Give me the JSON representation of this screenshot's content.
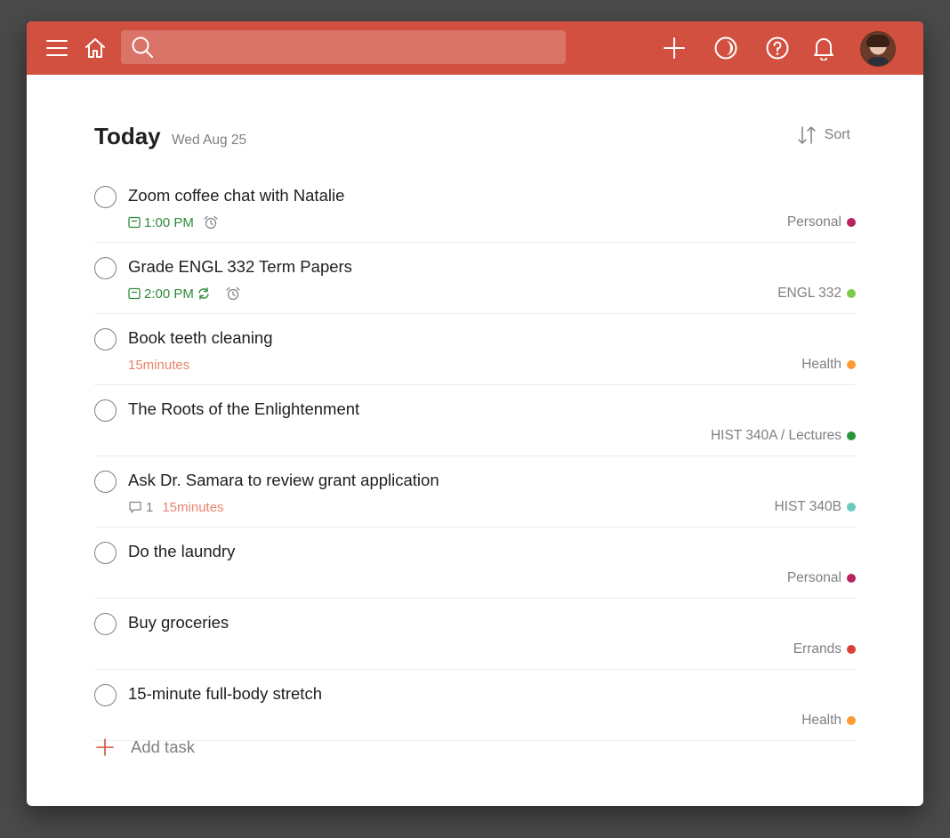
{
  "colors": {
    "topbar": "#d1503f",
    "search_bg": "#db7468",
    "due_green": "#2e8b3a",
    "duration_orange": "#e8846c",
    "add_plus": "#d1503f"
  },
  "topbar": {
    "icons": [
      "menu-icon",
      "home-icon",
      "search-icon",
      "plus-icon",
      "productivity-icon",
      "help-icon",
      "bell-icon"
    ],
    "search": {
      "placeholder": "",
      "value": ""
    }
  },
  "header": {
    "title": "Today",
    "date": "Wed Aug 25",
    "sort_label": "Sort"
  },
  "tasks": [
    {
      "title": "Zoom coffee chat with Natalie",
      "due": "1:00 PM",
      "recurring": false,
      "alarm": true,
      "project": "Personal",
      "project_color": "#b8255f"
    },
    {
      "title": "Grade ENGL 332 Term Papers",
      "due": "2:00 PM",
      "recurring": true,
      "alarm": true,
      "project": "ENGL 332",
      "project_color": "#7ecc49"
    },
    {
      "title": "Book teeth cleaning",
      "duration": "15minutes",
      "project": "Health",
      "project_color": "#ff9933"
    },
    {
      "title": "The Roots of the Enlightenment",
      "project": "HIST 340A / Lectures",
      "project_color": "#299438"
    },
    {
      "title": "Ask Dr. Samara to review grant application",
      "comments": "1",
      "duration": "15minutes",
      "project": "HIST 340B",
      "project_color": "#6accbc"
    },
    {
      "title": "Do the laundry",
      "project": "Personal",
      "project_color": "#b8255f"
    },
    {
      "title": "Buy groceries",
      "project": "Errands",
      "project_color": "#db4035"
    },
    {
      "title": "15-minute full-body stretch",
      "project": "Health",
      "project_color": "#ff9933"
    }
  ],
  "add_task_label": "Add task"
}
